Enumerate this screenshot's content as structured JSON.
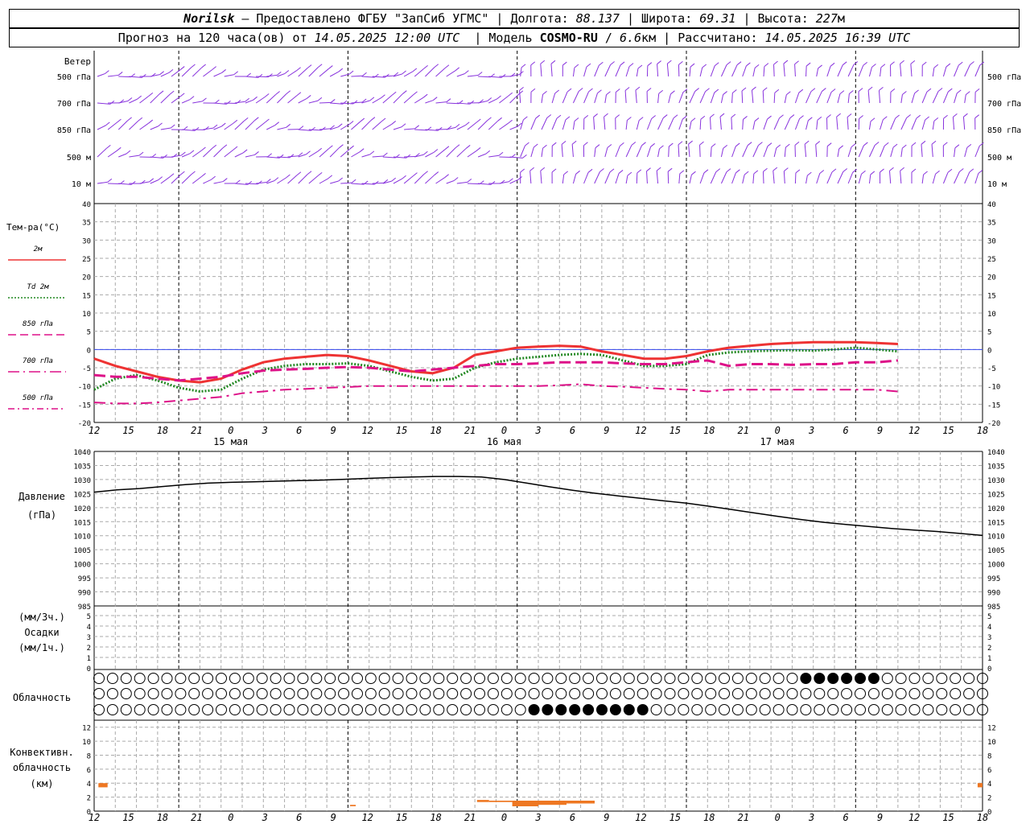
{
  "header": {
    "station": "Norilsk",
    "sep": "–",
    "provider": "Предоставлено ФГБУ \"ЗапСиб УГМС\"",
    "lon_label": "Долгота:",
    "lon_value": "88.137",
    "lat_label": "Широта:",
    "lat_value": "69.31",
    "alt_label": "Высота:",
    "alt_value": "227",
    "alt_unit": "м",
    "forecast_label": "Прогноз на 120 часа(ов) от",
    "forecast_from": "14.05.2025 12:00 UTC",
    "model_label": "Модель",
    "model_name": "COSMO-RU",
    "model_res": "6.6",
    "model_res_unit": "км",
    "computed_label": "Рассчитано:",
    "computed_at": "14.05.2025 16:39 UTC"
  },
  "time_axis": {
    "hour_ticks": [
      "12",
      "15",
      "18",
      "21",
      "0",
      "3",
      "6",
      "9",
      "12",
      "15",
      "18",
      "21",
      "0",
      "3",
      "6",
      "9",
      "12",
      "15",
      "18",
      "21",
      "0",
      "3",
      "6",
      "9",
      "12",
      "15",
      "18"
    ],
    "day_labels": [
      {
        "label": "15 мая",
        "tick_index": 4
      },
      {
        "label": "16 мая",
        "tick_index": 12
      },
      {
        "label": "17 мая",
        "tick_index": 20
      }
    ]
  },
  "wind_panel": {
    "title": "Ветер",
    "levels": [
      "500 гПа",
      "700 гПа",
      "850 гПа",
      "500 м",
      "10  м"
    ],
    "color": "#8833dd"
  },
  "temp_panel": {
    "title": "Тем-ра(°С)",
    "legend": [
      {
        "label": "2м",
        "color": "#ee3333",
        "style": "solid"
      },
      {
        "label": "Td  2м",
        "color": "#228822",
        "style": "dotted"
      },
      {
        "label": "850 гПа",
        "color": "#dd1188",
        "style": "dashed"
      },
      {
        "label": "700 гПа",
        "color": "#dd1188",
        "style": "longdash"
      },
      {
        "label": "500 гПа",
        "color": "#dd1188",
        "style": "dashdot"
      }
    ],
    "y_ticks": [
      "40",
      "35",
      "30",
      "25",
      "20",
      "15",
      "10",
      "5",
      "0",
      "-5",
      "-10",
      "-15",
      "-20"
    ]
  },
  "pressure_panel": {
    "title1": "Давление",
    "title2": "(гПа)",
    "y_ticks": [
      "1040",
      "1035",
      "1030",
      "1025",
      "1020",
      "1015",
      "1010",
      "1005",
      "1000",
      "995",
      "990",
      "985"
    ]
  },
  "precip_panel": {
    "title1": "(мм/3ч.)",
    "title2": "Осадки",
    "title3": "(мм/1ч.)",
    "y_ticks": [
      "5",
      "4",
      "3",
      "2",
      "1",
      "0"
    ]
  },
  "cloud_panel": {
    "title": "Облачность"
  },
  "conv_panel": {
    "title1": "Конвективн.",
    "title2": "облачность",
    "title3": "(км)",
    "y_ticks": [
      "12",
      "10",
      "8",
      "6",
      "4",
      "2",
      "0"
    ],
    "color": "#ee7722"
  },
  "chart_data": [
    {
      "type": "line",
      "title": "Тем-ра(°С)",
      "x_hours": [
        0,
        3,
        6,
        9,
        12,
        15,
        18,
        21,
        24,
        27,
        30,
        33,
        36,
        39,
        42,
        45,
        48,
        51,
        54,
        57,
        60,
        63,
        66,
        69,
        72,
        75,
        78,
        81,
        84,
        87,
        90,
        93,
        96,
        99,
        102,
        105,
        108,
        111,
        114,
        117,
        120,
        123,
        126
      ],
      "ylim": [
        -20,
        40
      ],
      "series": [
        {
          "name": "2м",
          "values": [
            -2.5,
            -4.5,
            -6.0,
            -7.5,
            -8.5,
            -9.0,
            -8.0,
            -5.5,
            -3.5,
            -2.5,
            -2.0,
            -1.5,
            -1.8,
            -3.0,
            -4.5,
            -6.0,
            -6.5,
            -5.0,
            -1.5,
            -0.5,
            0.5,
            0.8,
            1.0,
            0.8,
            -0.5,
            -1.5,
            -2.5,
            -2.5,
            -1.8,
            -0.5,
            0.5,
            1.0,
            1.5,
            1.8,
            2.0,
            2.0,
            2.0,
            1.8,
            1.5,
            null,
            null,
            null,
            null
          ]
        },
        {
          "name": "Td  2м",
          "values": [
            -11.0,
            -8.0,
            -7.0,
            -8.5,
            -10.5,
            -11.5,
            -11.0,
            -8.0,
            -5.5,
            -4.5,
            -4.0,
            -4.0,
            -3.8,
            -4.5,
            -6.0,
            -7.5,
            -8.5,
            -8.0,
            -5.0,
            -3.5,
            -2.5,
            -2.0,
            -1.5,
            -1.2,
            -1.5,
            -3.0,
            -4.5,
            -4.5,
            -4.0,
            -1.5,
            -0.8,
            -0.5,
            -0.3,
            -0.2,
            -0.3,
            0.0,
            0.5,
            0.0,
            -0.5,
            null,
            null,
            null,
            null
          ]
        },
        {
          "name": "850 гПа",
          "values": [
            -7.0,
            -7.5,
            -7.5,
            -8.0,
            -8.5,
            -8.0,
            -7.5,
            -6.5,
            -5.8,
            -5.5,
            -5.3,
            -5.0,
            -4.8,
            -5.0,
            -5.5,
            -6.0,
            -5.5,
            -5.0,
            -4.5,
            -4.0,
            -4.0,
            -3.8,
            -3.5,
            -3.5,
            -3.5,
            -3.8,
            -4.0,
            -4.0,
            -3.5,
            -3.0,
            -4.5,
            -4.0,
            -4.0,
            -4.2,
            -4.0,
            -4.0,
            -3.5,
            -3.5,
            -3.0,
            null,
            null,
            null,
            null
          ]
        },
        {
          "name": "700 гПа",
          "values": [
            -7.0,
            -7.5,
            -7.5,
            -8.0,
            -8.5,
            -8.0,
            -7.5,
            -6.5,
            -5.8,
            -5.5,
            -5.3,
            -5.0,
            -4.8,
            -5.0,
            -5.5,
            -6.0,
            -5.5,
            -5.0,
            -4.5,
            -4.0,
            -4.0,
            -3.8,
            -3.5,
            -3.5,
            -3.5,
            -3.8,
            -4.0,
            -4.0,
            -3.5,
            -3.0,
            -4.5,
            -4.0,
            -4.0,
            -4.2,
            -4.0,
            -4.0,
            -3.5,
            -3.5,
            -3.0,
            null,
            null,
            null,
            null
          ]
        },
        {
          "name": "500 гПа",
          "values": [
            -14.5,
            -14.8,
            -14.8,
            -14.5,
            -14.0,
            -13.5,
            -13.0,
            -12.0,
            -11.5,
            -11.0,
            -10.8,
            -10.5,
            -10.3,
            -10.0,
            -10.0,
            -10.0,
            -10.0,
            -10.0,
            -10.0,
            -10.0,
            -10.0,
            -10.0,
            -9.8,
            -9.5,
            -10.0,
            -10.2,
            -10.5,
            -10.8,
            -11.0,
            -11.5,
            -11.0,
            -11.0,
            -11.0,
            -11.0,
            -11.0,
            -11.0,
            -11.0,
            -11.0,
            -11.5,
            null,
            null,
            null,
            null
          ]
        }
      ]
    },
    {
      "type": "line",
      "title": "Давление",
      "x_hours": [
        0,
        3,
        6,
        9,
        12,
        15,
        18,
        21,
        24,
        27,
        30,
        33,
        36,
        39,
        42,
        45,
        48,
        51,
        54,
        57,
        60,
        63,
        66,
        69,
        72,
        75,
        78,
        81,
        84,
        87,
        90,
        93,
        96,
        99,
        102,
        105,
        108,
        111,
        114,
        117
      ],
      "ylim": [
        985,
        1040
      ],
      "series": [
        {
          "name": "Давление",
          "values": [
            1025.5,
            1026.3,
            1026.8,
            1027.5,
            1028.2,
            1028.7,
            1029.0,
            1029.2,
            1029.4,
            1029.6,
            1029.8,
            1030.1,
            1030.4,
            1030.7,
            1030.9,
            1031.1,
            1031.1,
            1030.9,
            1030.0,
            1028.7,
            1027.4,
            1026.2,
            1025.1,
            1024.2,
            1023.3,
            1022.4,
            1021.6,
            1020.5,
            1019.3,
            1018.1,
            1016.9,
            1015.8,
            1014.8,
            1014.0,
            1013.3,
            1012.6,
            1012.0,
            1011.5,
            1010.8,
            1010.1
          ]
        }
      ]
    },
    {
      "type": "bar",
      "title": "Конвективн. облачность (км)",
      "ylim": [
        0,
        13
      ],
      "segments": [
        {
          "from_h": 0.6,
          "to_h": 1.9,
          "bottom_km": 3.4,
          "top_km": 4.0
        },
        {
          "from_h": 36.3,
          "to_h": 37.1,
          "bottom_km": 0.7,
          "top_km": 0.9
        },
        {
          "from_h": 54.3,
          "to_h": 56.0,
          "bottom_km": 1.3,
          "top_km": 1.6
        },
        {
          "from_h": 56.0,
          "to_h": 59.3,
          "bottom_km": 1.3,
          "top_km": 1.5
        },
        {
          "from_h": 59.3,
          "to_h": 63.0,
          "bottom_km": 0.7,
          "top_km": 1.5
        },
        {
          "from_h": 63.0,
          "to_h": 67.0,
          "bottom_km": 0.9,
          "top_km": 1.5
        },
        {
          "from_h": 67.0,
          "to_h": 71.0,
          "bottom_km": 1.1,
          "top_km": 1.5
        },
        {
          "from_h": 125.3,
          "to_h": 126.0,
          "bottom_km": 3.4,
          "top_km": 4.0
        }
      ]
    }
  ]
}
